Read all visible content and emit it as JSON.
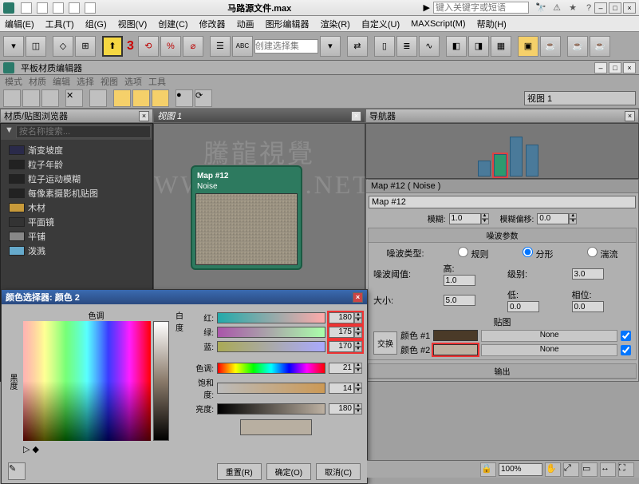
{
  "app": {
    "filename": "马路源文件.max",
    "search_placeholder": "键入关键字或短语"
  },
  "main_menu": [
    "编辑(E)",
    "工具(T)",
    "组(G)",
    "视图(V)",
    "创建(C)",
    "修改器",
    "动画",
    "图形编辑器",
    "渲染(R)",
    "自定义(U)",
    "MAXScript(M)",
    "帮助(H)"
  ],
  "toolbar": {
    "three": "3",
    "selset_placeholder": "创建选择集"
  },
  "mat_editor": {
    "title": "平板材质编辑器",
    "menus": [
      "模式",
      "材质",
      "编辑",
      "选择",
      "视图",
      "选项",
      "工具"
    ],
    "view_dropdown": "视图 1"
  },
  "browser": {
    "title": "材质/贴图浏览器",
    "search_placeholder": "按名称搜索...",
    "items": [
      {
        "label": "渐变坡度",
        "color": "#2a2a4a"
      },
      {
        "label": "粒子年龄",
        "color": "#222"
      },
      {
        "label": "粒子运动模糊",
        "color": "#222"
      },
      {
        "label": "每像素摄影机贴图",
        "color": "#222"
      },
      {
        "label": "木材",
        "color": "#c89a3a"
      },
      {
        "label": "平面镜",
        "color": "#333"
      },
      {
        "label": "平铺",
        "color": "#888"
      },
      {
        "label": "泼溅",
        "color": "#6ac"
      }
    ]
  },
  "viewport": {
    "title": "视图 1",
    "node_title": "Map #12",
    "node_type": "Noise"
  },
  "navigator": {
    "title": "导航器"
  },
  "props": {
    "header": "Map #12  ( Noise )",
    "name": "Map #12",
    "blur_label": "模糊:",
    "blur": "1.0",
    "blur_off_label": "模糊偏移:",
    "blur_off": "0.0",
    "noise_params_title": "噪波参数",
    "type_label": "噪波类型:",
    "type_opts": [
      "规则",
      "分形",
      "湍流"
    ],
    "type_sel": 1,
    "thresh_label": "噪波阈值:",
    "high_label": "高:",
    "high": "1.0",
    "levels_label": "级别:",
    "levels": "3.0",
    "low_label": "低:",
    "low": "0.0",
    "phase_label": "相位:",
    "phase": "0.0",
    "size_label": "大小:",
    "size": "5.0",
    "maps_title": "贴图",
    "swap_label": "交换",
    "color1_label": "颜色 #1",
    "color1": "#4a3a28",
    "map1": "None",
    "color2_label": "颜色 #2",
    "color2": "#bdb1a2",
    "map2": "None",
    "output_title": "输出"
  },
  "color_dlg": {
    "title": "颜色选择器: 颜色 2",
    "hue_label": "色调",
    "white_label": "白度",
    "black_label": "黑度",
    "r_label": "红:",
    "r": "180",
    "g_label": "绿:",
    "g": "175",
    "b_label": "蓝:",
    "b": "170",
    "h_label": "色调:",
    "h": "21",
    "s_label": "饱和度:",
    "s": "14",
    "v_label": "亮度:",
    "v": "180",
    "reset": "重置(R)",
    "ok": "确定(O)",
    "cancel": "取消(C)"
  },
  "status": {
    "zoom": "100%"
  }
}
